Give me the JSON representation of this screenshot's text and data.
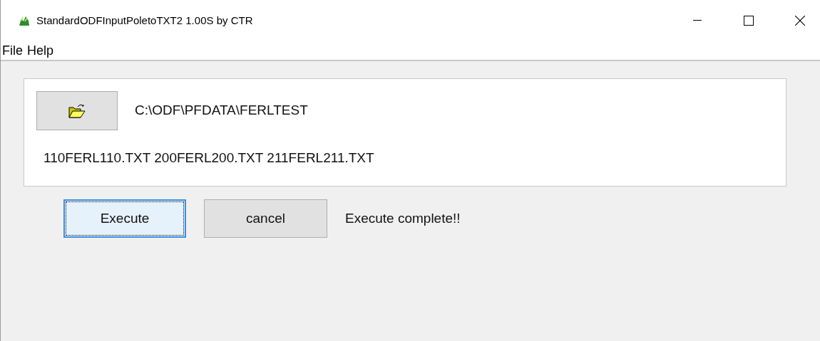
{
  "window": {
    "title": "StandardODFInputPoletoTXT2 1.00S by CTR"
  },
  "menu": [
    "File",
    "Help"
  ],
  "folder": {
    "path": "C:\\ODF\\PFDATA\\FERLTEST",
    "files": "110FERL110.TXT 200FERL200.TXT 211FERL211.TXT"
  },
  "buttons": [
    {
      "label": "Execute",
      "focused": true
    },
    {
      "label": "cancel",
      "focused": false
    }
  ],
  "status": "Execute complete!!"
}
